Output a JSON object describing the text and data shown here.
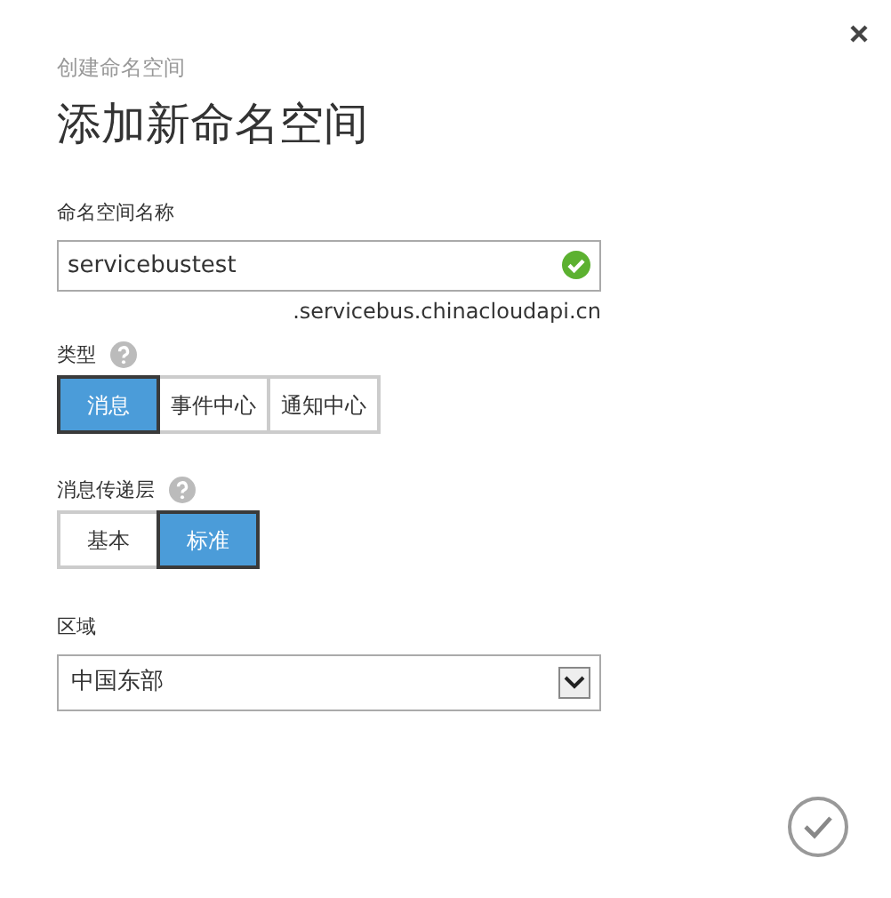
{
  "dialog": {
    "breadcrumb": "创建命名空间",
    "title": "添加新命名空间"
  },
  "namespace_name": {
    "label": "命名空间名称",
    "value": "servicebustest",
    "valid": true,
    "suffix": ".servicebus.chinacloudapi.cn"
  },
  "type": {
    "label": "类型",
    "options": [
      {
        "label": "消息",
        "selected": true
      },
      {
        "label": "事件中心",
        "selected": false
      },
      {
        "label": "通知中心",
        "selected": false
      }
    ]
  },
  "messaging_tier": {
    "label": "消息传递层",
    "options": [
      {
        "label": "基本",
        "selected": false
      },
      {
        "label": "标准",
        "selected": true
      }
    ]
  },
  "region": {
    "label": "区域",
    "value": "中国东部"
  }
}
